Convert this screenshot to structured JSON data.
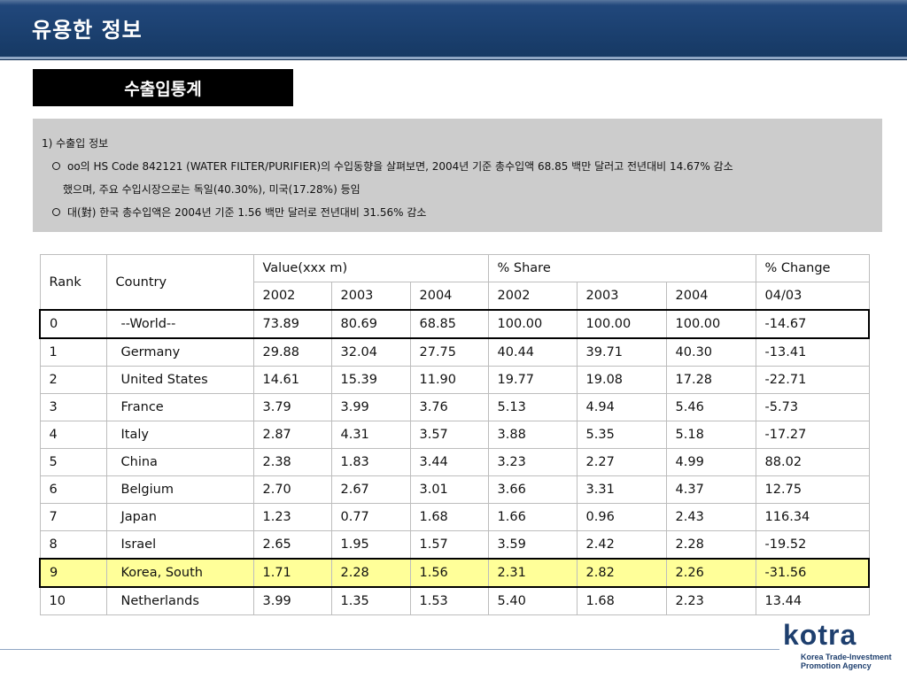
{
  "header": {
    "title": "유용한 정보"
  },
  "section": {
    "label": "수출입통계"
  },
  "info": {
    "heading": "1) 수출입 정보",
    "bullet1_line1": "oo의 HS Code 842121 (WATER FILTER/PURIFIER)의 수입동향을 살펴보면, 2004년 기준 총수입액 68.85 백만 달러고 전년대비 14.67% 감소",
    "bullet1_line2": "했으며, 주요 수입시장으로는 독일(40.30%), 미국(17.28%) 등임",
    "bullet2": "대(對) 한국 총수입액은 2004년 기준 1.56 백만 달러로 전년대비 31.56% 감소"
  },
  "table": {
    "headers": {
      "rank": "Rank",
      "country": "Country",
      "value": "Value(xxx m)",
      "share": "% Share",
      "change": "% Change"
    },
    "subheaders": [
      "2002",
      "2003",
      "2004",
      "2002",
      "2003",
      "2004",
      "04/03"
    ],
    "rows": [
      [
        "0",
        "--World--",
        "73.89",
        "80.69",
        "68.85",
        "100.00",
        "100.00",
        "100.00",
        "-14.67"
      ],
      [
        "1",
        "Germany",
        "29.88",
        "32.04",
        "27.75",
        "40.44",
        "39.71",
        "40.30",
        "-13.41"
      ],
      [
        "2",
        "United States",
        "14.61",
        "15.39",
        "11.90",
        "19.77",
        "19.08",
        "17.28",
        "-22.71"
      ],
      [
        "3",
        "France",
        "3.79",
        "3.99",
        "3.76",
        "5.13",
        "4.94",
        "5.46",
        "-5.73"
      ],
      [
        "4",
        "Italy",
        "2.87",
        "4.31",
        "3.57",
        "3.88",
        "5.35",
        "5.18",
        "-17.27"
      ],
      [
        "5",
        "China",
        "2.38",
        "1.83",
        "3.44",
        "3.23",
        "2.27",
        "4.99",
        "88.02"
      ],
      [
        "6",
        "Belgium",
        "2.70",
        "2.67",
        "3.01",
        "3.66",
        "3.31",
        "4.37",
        "12.75"
      ],
      [
        "7",
        "Japan",
        "1.23",
        "0.77",
        "1.68",
        "1.66",
        "0.96",
        "2.43",
        "116.34"
      ],
      [
        "8",
        "Israel",
        "2.65",
        "1.95",
        "1.57",
        "3.59",
        "2.42",
        "2.28",
        "-19.52"
      ],
      [
        "9",
        "Korea, South",
        "1.71",
        "2.28",
        "1.56",
        "2.31",
        "2.82",
        "2.26",
        "-31.56"
      ],
      [
        "10",
        "Netherlands",
        "3.99",
        "1.35",
        "1.53",
        "5.40",
        "1.68",
        "2.23",
        "13.44"
      ]
    ]
  },
  "footer": {
    "logo_text": "kotra",
    "logo_sub_line1": "Korea Trade-Investment",
    "logo_sub_line2": "Promotion Agency"
  },
  "colors": {
    "header_bg": "#1b416f",
    "highlight_row": "#ffff99",
    "info_box_bg": "#cccccc",
    "logo_color": "#1e3f6e"
  }
}
